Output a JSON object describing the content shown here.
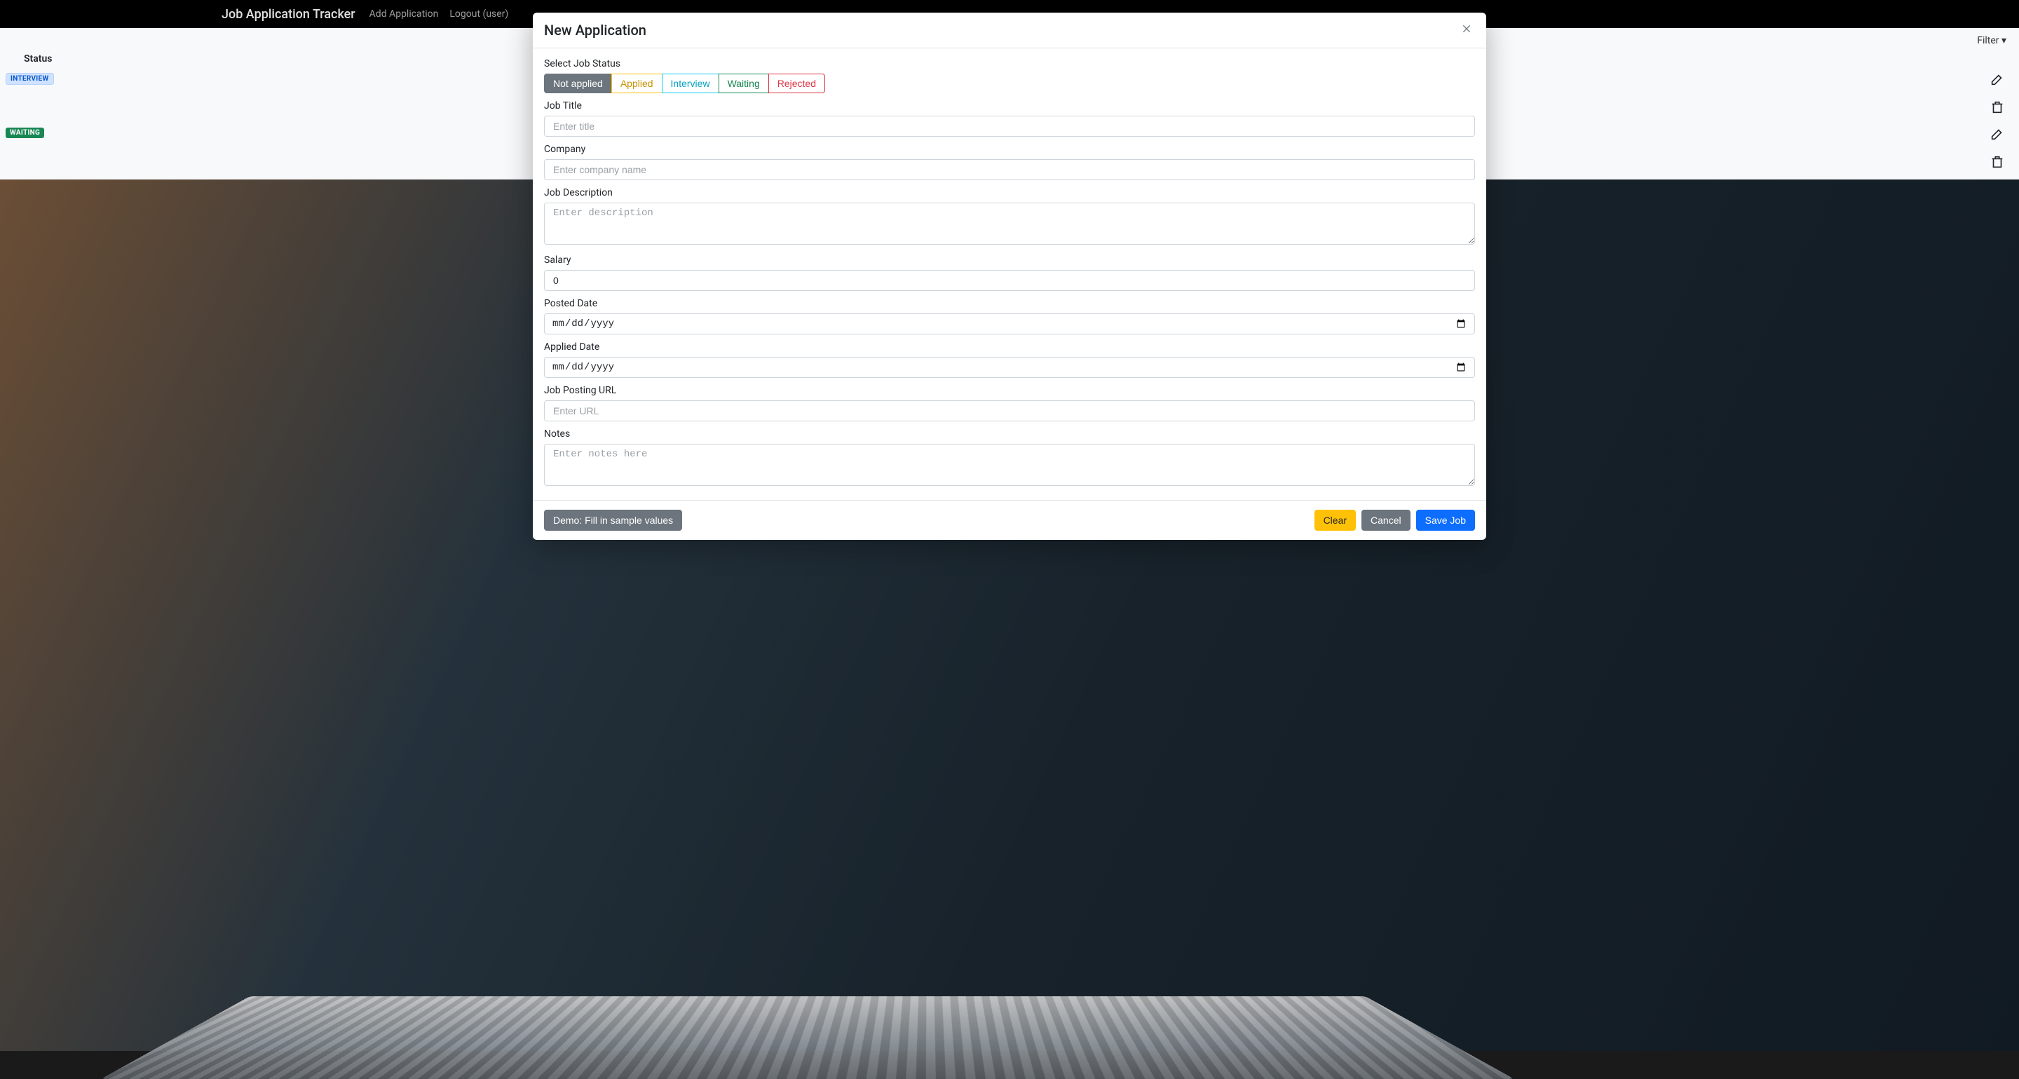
{
  "background": {
    "brand": "Job Application Tracker",
    "nav_add": "Add Application",
    "nav_logout": "Logout (user)",
    "filter_label": "Filter ▾",
    "status_header": "Status",
    "badge_interview": "INTERVIEW",
    "badge_waiting": "WAITING"
  },
  "modal": {
    "title": "New Application",
    "status_label": "Select Job Status",
    "status_options": {
      "not_applied": "Not applied",
      "applied": "Applied",
      "interview": "Interview",
      "waiting": "Waiting",
      "rejected": "Rejected"
    },
    "fields": {
      "title_label": "Job Title",
      "title_placeholder": "Enter title",
      "company_label": "Company",
      "company_placeholder": "Enter company name",
      "description_label": "Job Description",
      "description_placeholder": "Enter description",
      "salary_label": "Salary",
      "salary_value": "0",
      "posted_label": "Posted Date",
      "date_placeholder": "mm/dd/yyyy",
      "applied_label": "Applied Date",
      "url_label": "Job Posting URL",
      "url_placeholder": "Enter URL",
      "notes_label": "Notes",
      "notes_placeholder": "Enter notes here"
    },
    "buttons": {
      "demo": "Demo: Fill in sample values",
      "clear": "Clear",
      "cancel": "Cancel",
      "save": "Save Job"
    }
  }
}
